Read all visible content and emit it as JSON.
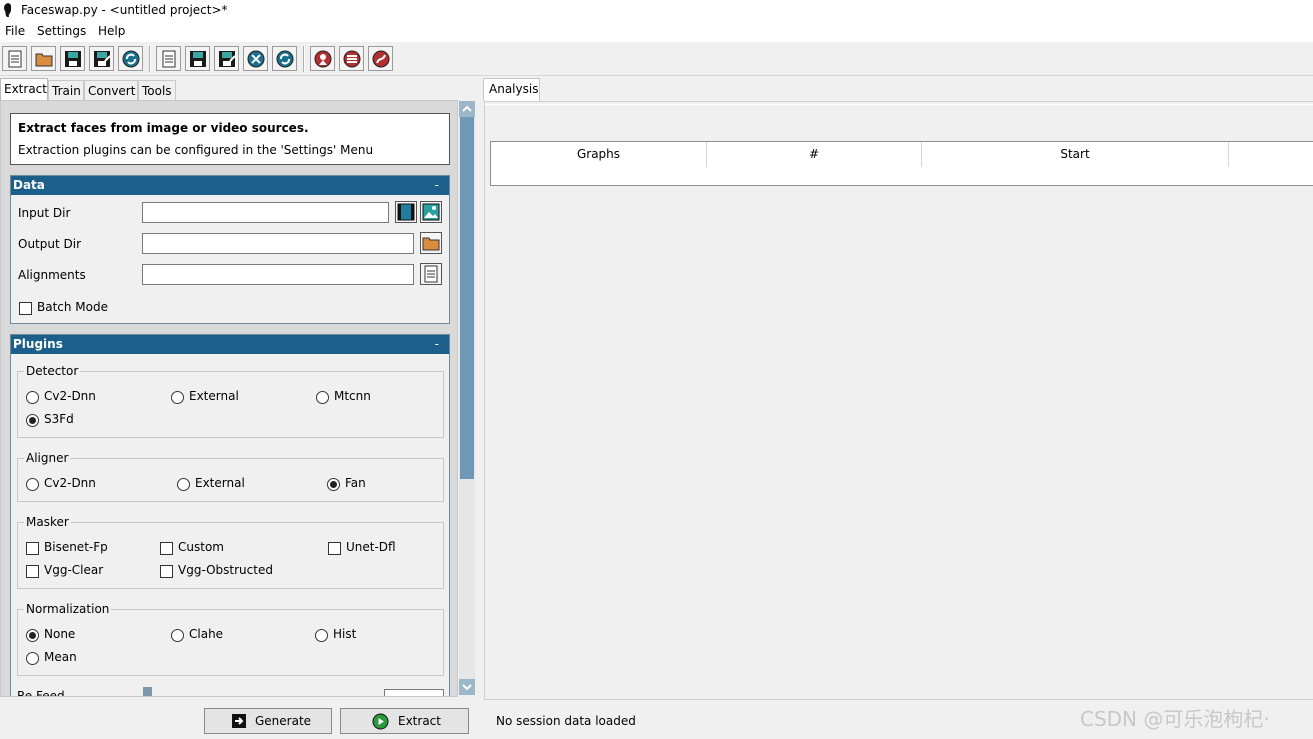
{
  "window": {
    "title": "Faceswap.py - <untitled project>*"
  },
  "menu": {
    "items": [
      "File",
      "Settings",
      "Help"
    ]
  },
  "toolbar": {
    "icons": [
      "new-project-icon",
      "open-project-icon",
      "save-project-icon",
      "save-project-as-icon",
      "reload-project-icon",
      "new-task-icon",
      "save-task-icon",
      "save-task-as-icon",
      "clear-task-icon",
      "reload-task-icon",
      "donate-icon",
      "patreon-icon",
      "github-icon"
    ]
  },
  "left_tabs": [
    "Extract",
    "Train",
    "Convert",
    "Tools"
  ],
  "info": {
    "heading": "Extract faces from image or video sources.",
    "sub": "Extraction plugins can be configured in the 'Settings' Menu"
  },
  "data_section": {
    "title": "Data",
    "collapse": "-",
    "input_dir_label": "Input Dir",
    "output_dir_label": "Output Dir",
    "alignments_label": "Alignments",
    "batch_mode_label": "Batch Mode"
  },
  "plugins_section": {
    "title": "Plugins",
    "collapse": "-",
    "detector": {
      "title": "Detector",
      "options": [
        "Cv2-Dnn",
        "External",
        "Mtcnn",
        "S3Fd"
      ],
      "selected": "S3Fd"
    },
    "aligner": {
      "title": "Aligner",
      "options": [
        "Cv2-Dnn",
        "External",
        "Fan"
      ],
      "selected": "Fan"
    },
    "masker": {
      "title": "Masker",
      "options": [
        "Bisenet-Fp",
        "Custom",
        "Unet-Dfl",
        "Vgg-Clear",
        "Vgg-Obstructed"
      ]
    },
    "normalization": {
      "title": "Normalization",
      "options": [
        "None",
        "Clahe",
        "Hist",
        "Mean"
      ],
      "selected": "None"
    },
    "partial_label": "Re Feed"
  },
  "buttons": {
    "generate": "Generate",
    "extract": "Extract"
  },
  "right": {
    "tab": "Analysis",
    "columns": [
      "Graphs",
      "#",
      "Start"
    ],
    "status": "No session data loaded"
  },
  "watermark": "CSDN @可乐泡枸杞·"
}
